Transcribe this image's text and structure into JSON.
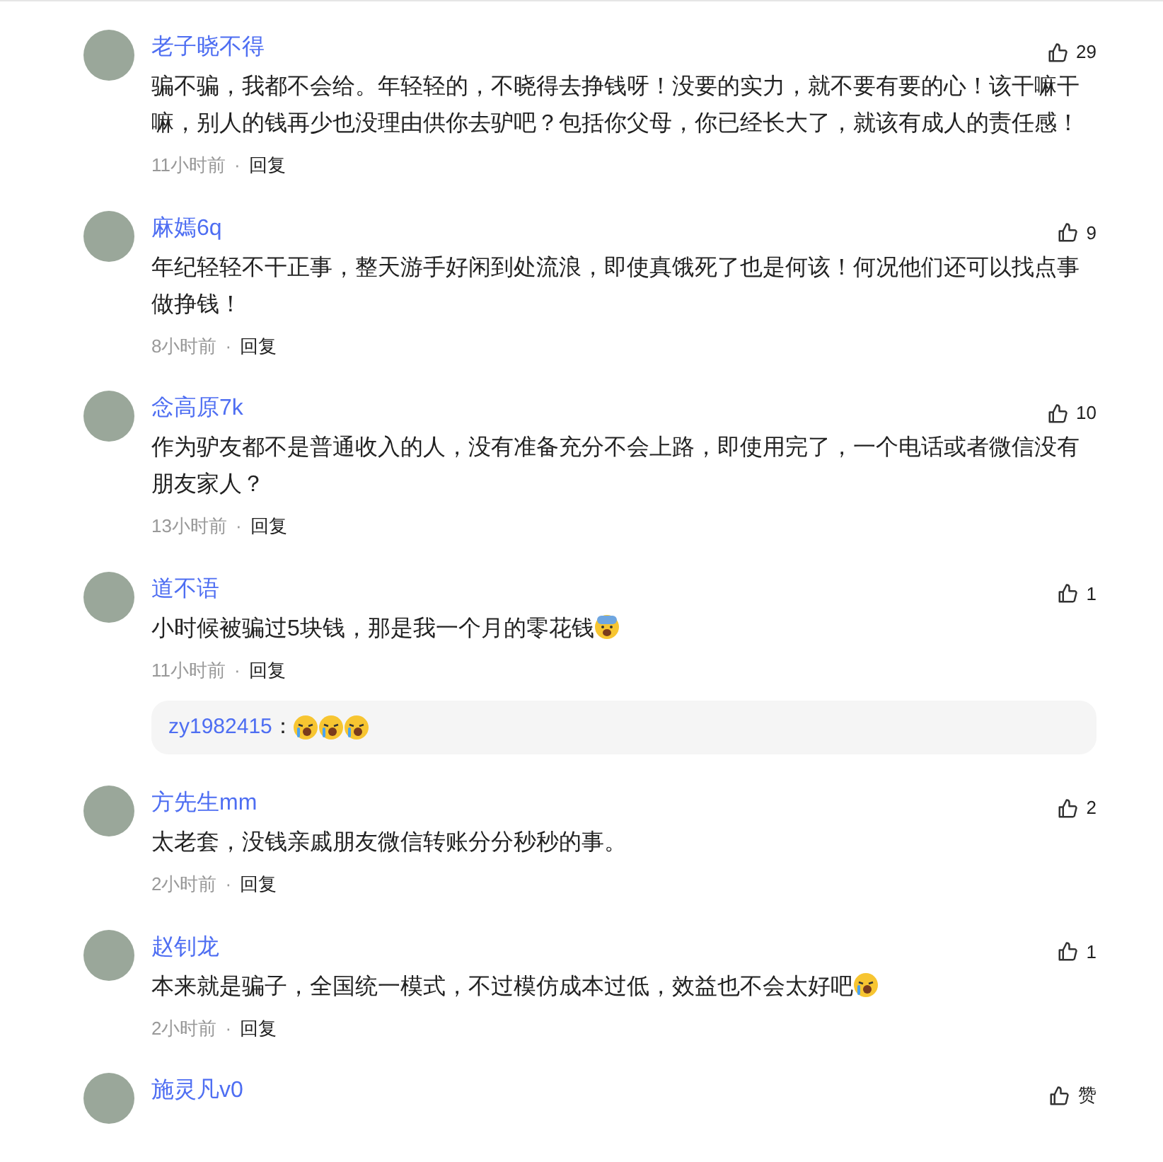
{
  "comments": [
    {
      "name": "老子晓不得",
      "likes": "29",
      "text": "骗不骗，我都不会给。年轻轻的，不晓得去挣钱呀！没要的实力，就不要有要的心！该干嘛干嘛，别人的钱再少也没理由供你去驴吧？包括你父母，你已经长大了，就该有成人的责任感！",
      "time": "11小时前",
      "sep": "·",
      "reply": "回复"
    },
    {
      "name": "麻嫣6q",
      "likes": "9",
      "text": "年纪轻轻不干正事，整天游手好闲到处流浪，即使真饿死了也是何该！何况他们还可以找点事做挣钱！",
      "time": "8小时前",
      "sep": "·",
      "reply": "回复"
    },
    {
      "name": "念高原7k",
      "likes": "10",
      "text": "作为驴友都不是普通收入的人，没有准备充分不会上路，即使用完了，一个电话或者微信没有朋友家人？",
      "time": "13小时前",
      "sep": "·",
      "reply": "回复"
    },
    {
      "name": "道不语",
      "likes": "1",
      "text": "小时候被骗过5块钱，那是我一个月的零花钱",
      "emojis": [
        {
          "kind": "sweat"
        }
      ],
      "time": "11小时前",
      "sep": "·",
      "reply": "回复",
      "replies": [
        {
          "name": "zy1982415",
          "sep": "：",
          "emojis": [
            {
              "kind": "crying"
            },
            {
              "kind": "crying"
            },
            {
              "kind": "crying"
            }
          ]
        }
      ]
    },
    {
      "name": "方先生mm",
      "likes": "2",
      "text": "太老套，没钱亲戚朋友微信转账分分秒秒的事。",
      "time": "2小时前",
      "sep": "·",
      "reply": "回复"
    },
    {
      "name": "赵钊龙",
      "likes": "1",
      "text": "本来就是骗子，全国统一模式，不过模仿成本过低，效益也不会太好吧",
      "emojis": [
        {
          "kind": "crying"
        }
      ],
      "time": "2小时前",
      "sep": "·",
      "reply": "回复"
    },
    {
      "name": "施灵凡v0",
      "likes": "赞"
    }
  ]
}
